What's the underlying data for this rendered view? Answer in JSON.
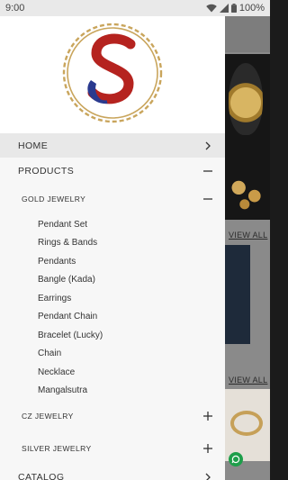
{
  "status_bar": {
    "time": "9:00",
    "battery": "100%"
  },
  "drawer": {
    "logo_name": "brand-logo-s",
    "items": {
      "home": {
        "label": "HOME"
      },
      "products": {
        "label": "PRODUCTS"
      },
      "gold_jewelry": {
        "label": "GOLD JEWELRY",
        "subitems": [
          "Pendant Set",
          "Rings & Bands",
          "Pendants",
          "Bangle (Kada)",
          "Earrings",
          "Pendant Chain",
          "Bracelet (Lucky)",
          "Chain",
          "Necklace",
          "Mangalsutra"
        ]
      },
      "cz_jewelry": {
        "label": "CZ JEWELRY"
      },
      "silver_jewelry": {
        "label": "SILVER JEWELRY"
      },
      "catalog": {
        "label": "CATALOG"
      }
    }
  },
  "background_app": {
    "view_all_1": "VIEW ALL",
    "view_all_2": "VIEW ALL"
  },
  "colors": {
    "logo_gold": "#c9a55c",
    "logo_red": "#b5231f",
    "logo_blue": "#2a3a8f",
    "drawer_bg": "#f7f7f7",
    "home_highlight": "#e8e8e8"
  }
}
